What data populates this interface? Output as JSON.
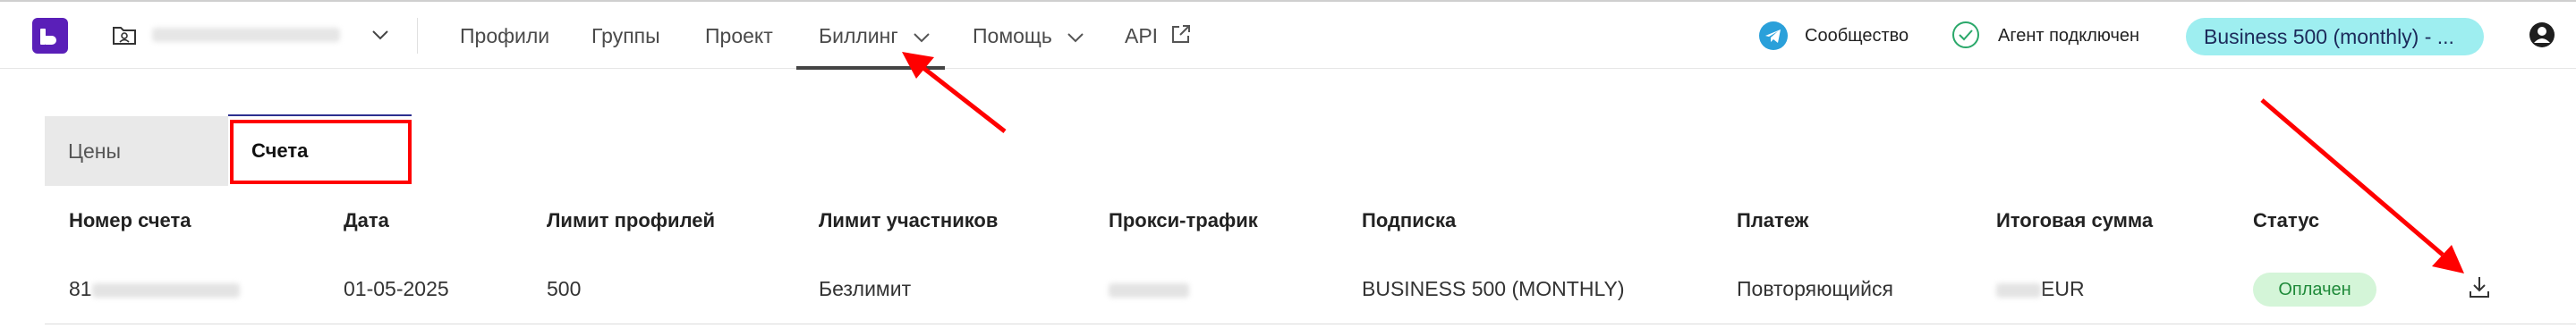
{
  "header": {
    "logo": "brand-logo",
    "workspace_name": "",
    "nav": [
      {
        "label": "Профили"
      },
      {
        "label": "Группы"
      },
      {
        "label": "Проект"
      },
      {
        "label": "Биллинг"
      },
      {
        "label": "Помощь"
      },
      {
        "label": "API"
      }
    ],
    "community_label": "Сообщество",
    "agent_label": "Агент подключен",
    "plan_label": "Business 500 (monthly) - ..."
  },
  "tabs": [
    {
      "label": "Цены"
    },
    {
      "label": "Счета"
    }
  ],
  "table": {
    "columns": [
      "Номер счета",
      "Дата",
      "Лимит профилей",
      "Лимит участников",
      "Прокси-трафик",
      "Подписка",
      "Платеж",
      "Итоговая сумма",
      "Статус"
    ],
    "rows": [
      {
        "invoice_number": "81",
        "date": "01-05-2025",
        "profile_limit": "500",
        "member_limit": "Безлимит",
        "proxy_traffic": "",
        "subscription": "BUSINESS 500 (MONTHLY)",
        "payment": "Повторяющийся",
        "total_currency": "EUR",
        "status": "Оплачен"
      }
    ]
  },
  "colors": {
    "brand": "#5a1fb8",
    "plan_pill": "#9eeef0",
    "status_paid_bg": "#d4f5d8",
    "status_paid_text": "#1f8a3a",
    "annotation": "#ff0000"
  },
  "icons": [
    "folder-icon",
    "chevron-down-icon",
    "external-link-icon",
    "telegram-icon",
    "check-circle-icon",
    "user-icon",
    "download-icon"
  ]
}
